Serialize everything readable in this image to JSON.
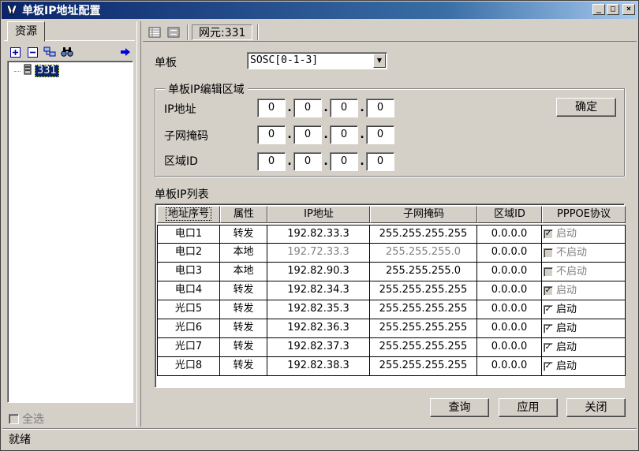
{
  "window": {
    "title": "单板IP地址配置",
    "btn_min": "_",
    "btn_max": "□",
    "btn_close": "×"
  },
  "left": {
    "tab": "资源",
    "tree_node": "331",
    "select_all": "全选"
  },
  "toolbar": {
    "ne_label": "网元:331"
  },
  "board": {
    "label": "单板",
    "value": "SOSC[0-1-3]"
  },
  "edit": {
    "group_title": "单板IP编辑区域",
    "ip_label": "IP地址",
    "mask_label": "子网掩码",
    "area_label": "区域ID",
    "ip": [
      "0",
      "0",
      "0",
      "0"
    ],
    "mask": [
      "0",
      "0",
      "0",
      "0"
    ],
    "area": [
      "0",
      "0",
      "0",
      "0"
    ],
    "confirm": "确定"
  },
  "list": {
    "title": "单板IP列表",
    "headers": [
      "地址序号",
      "属性",
      "IP地址",
      "子网掩码",
      "区域ID",
      "PPPOE协议"
    ],
    "rows": [
      {
        "port": "电口1",
        "attr": "转发",
        "ip": "192.82.33.3",
        "mask": "255.255.255.255",
        "area": "0.0.0.0",
        "pppoe": "启动",
        "checked": true,
        "enabled": false,
        "grey": false
      },
      {
        "port": "电口2",
        "attr": "本地",
        "ip": "192.72.33.3",
        "mask": "255.255.255.0",
        "area": "0.0.0.0",
        "pppoe": "不启动",
        "checked": false,
        "enabled": false,
        "grey": true
      },
      {
        "port": "电口3",
        "attr": "本地",
        "ip": "192.82.90.3",
        "mask": "255.255.255.0",
        "area": "0.0.0.0",
        "pppoe": "不启动",
        "checked": false,
        "enabled": false,
        "grey": false
      },
      {
        "port": "电口4",
        "attr": "转发",
        "ip": "192.82.34.3",
        "mask": "255.255.255.255",
        "area": "0.0.0.0",
        "pppoe": "启动",
        "checked": true,
        "enabled": false,
        "grey": false
      },
      {
        "port": "光口5",
        "attr": "转发",
        "ip": "192.82.35.3",
        "mask": "255.255.255.255",
        "area": "0.0.0.0",
        "pppoe": "启动",
        "checked": true,
        "enabled": true,
        "grey": false
      },
      {
        "port": "光口6",
        "attr": "转发",
        "ip": "192.82.36.3",
        "mask": "255.255.255.255",
        "area": "0.0.0.0",
        "pppoe": "启动",
        "checked": true,
        "enabled": true,
        "grey": false
      },
      {
        "port": "光口7",
        "attr": "转发",
        "ip": "192.82.37.3",
        "mask": "255.255.255.255",
        "area": "0.0.0.0",
        "pppoe": "启动",
        "checked": true,
        "enabled": true,
        "grey": false
      },
      {
        "port": "光口8",
        "attr": "转发",
        "ip": "192.82.38.3",
        "mask": "255.255.255.255",
        "area": "0.0.0.0",
        "pppoe": "启动",
        "checked": true,
        "enabled": true,
        "grey": false
      }
    ]
  },
  "buttons": {
    "query": "查询",
    "apply": "应用",
    "close": "关闭"
  },
  "status": {
    "text": "就绪"
  }
}
